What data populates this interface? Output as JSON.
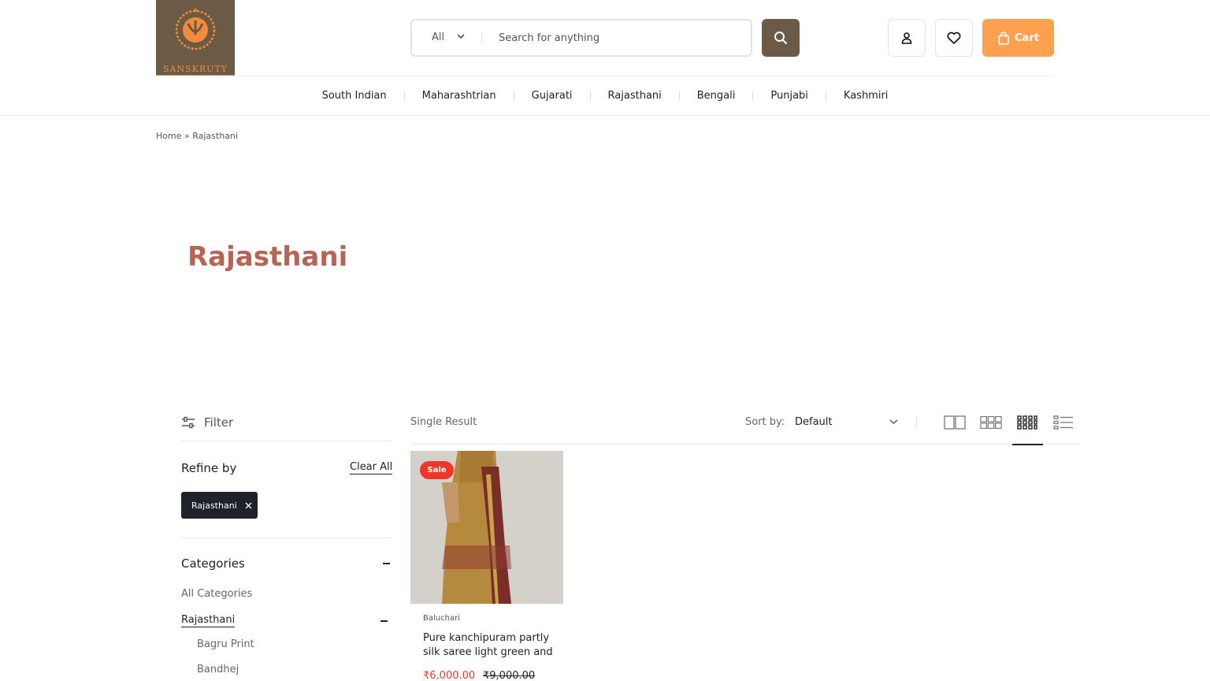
{
  "brand": {
    "name": "SANSKRUTY"
  },
  "search": {
    "category": "All",
    "placeholder": "Search for anything"
  },
  "header": {
    "cart_label": "Cart"
  },
  "nav": {
    "items": [
      "South Indian",
      "Maharashtrian",
      "Gujarati",
      "Rajasthani",
      "Bengali",
      "Punjabi",
      "Kashmiri"
    ]
  },
  "breadcrumb": {
    "home": "Home",
    "separator": "»",
    "current": "Rajasthani"
  },
  "page": {
    "title": "Rajasthani"
  },
  "filter": {
    "label": "Filter",
    "refine_label": "Refine by",
    "clear_label": "Clear All",
    "active_tag": "Rajasthani",
    "categories_label": "Categories",
    "categories": [
      "All Categories",
      "Rajasthani"
    ],
    "subcategories": [
      "Bagru Print",
      "Bandhej"
    ]
  },
  "toolbar": {
    "result_count": "Single Result",
    "sort_label": "Sort by:",
    "sort_value": "Default"
  },
  "product": {
    "badge": "Sale",
    "category": "Baluchari",
    "title": "Pure kanchipuram partly silk saree light green and",
    "price_sale": "₹6,000.00",
    "price_regular": "₹9,000.00"
  },
  "colors": {
    "brand": "#6b5a45",
    "accent": "#fda14e",
    "title": "#b86454",
    "sale": "#f0362b"
  }
}
